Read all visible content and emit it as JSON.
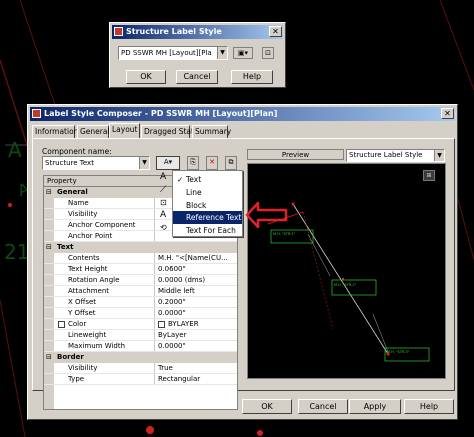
{
  "structure_label_dialog": {
    "title": "Structure Label Style",
    "style_combo_value": "PD SSWR MH [Layout][Pla",
    "ok": "OK",
    "cancel": "Cancel",
    "help": "Help"
  },
  "composer": {
    "title": "Label Style Composer - PD SSWR MH [Layout][Plan]",
    "tabs": [
      "Information",
      "General",
      "Layout",
      "Dragged State",
      "Summary"
    ],
    "active_tab": "Layout",
    "component_name_label": "Component name:",
    "component_name_value": "Structure Text",
    "property_header": "Property",
    "properties": [
      {
        "type": "section",
        "name": "General"
      },
      {
        "type": "prop",
        "name": "Name",
        "value": ""
      },
      {
        "type": "prop",
        "name": "Visibility",
        "value": ""
      },
      {
        "type": "prop",
        "name": "Anchor Component",
        "value": ""
      },
      {
        "type": "prop",
        "name": "Anchor Point",
        "value": ""
      },
      {
        "type": "section",
        "name": "Text"
      },
      {
        "type": "prop",
        "name": "Contents",
        "value": "M.H. \"<[Name(CU..."
      },
      {
        "type": "prop",
        "name": "Text Height",
        "value": "0.0600\""
      },
      {
        "type": "prop",
        "name": "Rotation Angle",
        "value": "0.0000 (dms)"
      },
      {
        "type": "prop",
        "name": "Attachment",
        "value": "Middle left"
      },
      {
        "type": "prop",
        "name": "X Offset",
        "value": "0.2000\""
      },
      {
        "type": "prop",
        "name": "Y Offset",
        "value": "0.0000\""
      },
      {
        "type": "prop",
        "name": "Color",
        "value": "BYLAYER"
      },
      {
        "type": "prop",
        "name": "Lineweight",
        "value": "ByLayer"
      },
      {
        "type": "prop",
        "name": "Maximum Width",
        "value": "0.0000\""
      },
      {
        "type": "section",
        "name": "Border"
      },
      {
        "type": "prop",
        "name": "Visibility",
        "value": "True"
      },
      {
        "type": "prop",
        "name": "Type",
        "value": "Rectangular"
      }
    ],
    "preview_label": "Preview",
    "preview_combo_value": "Structure Label Style",
    "dropdown_menu": [
      "Text",
      "Line",
      "Block",
      "Reference Text",
      "Text For Each"
    ],
    "menu_selected": "Reference Text",
    "menu_checked": "Text",
    "ok": "OK",
    "cancel": "Cancel",
    "apply": "Apply",
    "help": "Help"
  },
  "background_text": {
    "left_a": "A",
    "left_21": "21",
    "right_a": "A"
  },
  "preview_labels": [
    "M.H. \"STR-1\"",
    "M.H. \"STR-2\"",
    "M.H. \"STR-3\""
  ],
  "colors": {
    "titlebar": "#0a246a",
    "highlight": "#0a246a",
    "annotation_arrow": "#e0202a",
    "preview_text": "#2fd12f"
  },
  "icons": [
    "add-component-icon",
    "copy-component-icon",
    "delete-component-icon",
    "component-order-icon",
    "edit-style-icon",
    "preview-zoom-icon"
  ]
}
